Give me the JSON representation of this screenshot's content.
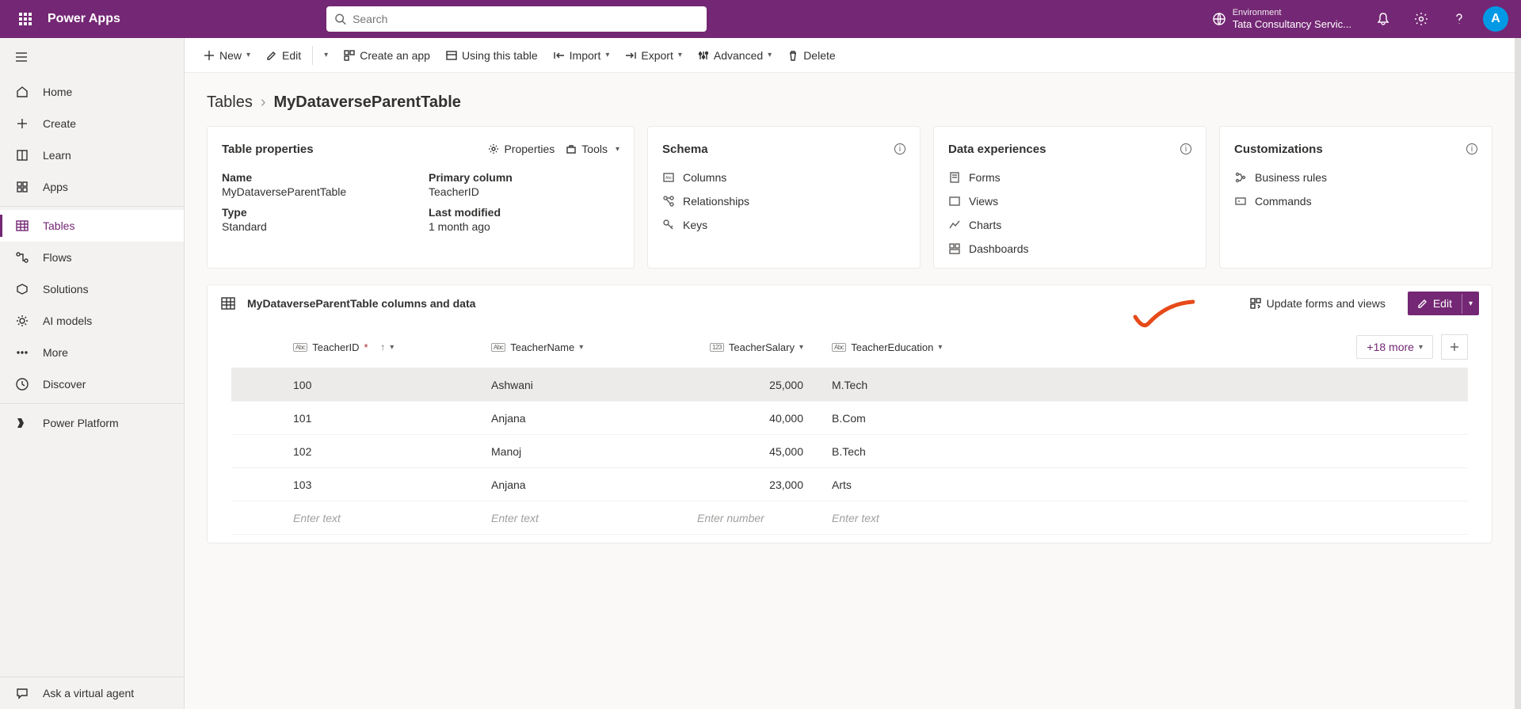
{
  "brand": "Power Apps",
  "search": {
    "placeholder": "Search"
  },
  "environment": {
    "label": "Environment",
    "name": "Tata Consultancy Servic..."
  },
  "avatar_initial": "A",
  "leftnav": {
    "items": [
      {
        "label": "Home"
      },
      {
        "label": "Create"
      },
      {
        "label": "Learn"
      },
      {
        "label": "Apps"
      },
      {
        "label": "Tables"
      },
      {
        "label": "Flows"
      },
      {
        "label": "Solutions"
      },
      {
        "label": "AI models"
      },
      {
        "label": "More"
      },
      {
        "label": "Discover"
      }
    ],
    "platform": "Power Platform",
    "ask": "Ask a virtual agent"
  },
  "toolbar": {
    "new": "New",
    "edit": "Edit",
    "create_app": "Create an app",
    "using_table": "Using this table",
    "import": "Import",
    "export": "Export",
    "advanced": "Advanced",
    "delete": "Delete"
  },
  "breadcrumb": {
    "root": "Tables",
    "current": "MyDataverseParentTable"
  },
  "properties_card": {
    "title": "Table properties",
    "properties_link": "Properties",
    "tools_link": "Tools",
    "name_label": "Name",
    "name_value": "MyDataverseParentTable",
    "primary_label": "Primary column",
    "primary_value": "TeacherID",
    "type_label": "Type",
    "type_value": "Standard",
    "modified_label": "Last modified",
    "modified_value": "1 month ago"
  },
  "schema_card": {
    "title": "Schema",
    "links": [
      "Columns",
      "Relationships",
      "Keys"
    ]
  },
  "data_card": {
    "title": "Data experiences",
    "links": [
      "Forms",
      "Views",
      "Charts",
      "Dashboards"
    ]
  },
  "custom_card": {
    "title": "Customizations",
    "links": [
      "Business rules",
      "Commands"
    ]
  },
  "grid": {
    "title": "MyDataverseParentTable columns and data",
    "update_link": "Update forms and views",
    "edit_btn": "Edit",
    "more_cols": "+18 more",
    "columns": [
      {
        "type": "Abc",
        "name": "TeacherID",
        "primary": true,
        "sort": "asc"
      },
      {
        "type": "Abc",
        "name": "TeacherName"
      },
      {
        "type": "123",
        "name": "TeacherSalary"
      },
      {
        "type": "Abc",
        "name": "TeacherEducation"
      }
    ],
    "rows": [
      {
        "id": "100",
        "name": "Ashwani",
        "salary": "25,000",
        "edu": "M.Tech",
        "selected": true
      },
      {
        "id": "101",
        "name": "Anjana",
        "salary": "40,000",
        "edu": "B.Com"
      },
      {
        "id": "102",
        "name": "Manoj",
        "salary": "45,000",
        "edu": "B.Tech"
      },
      {
        "id": "103",
        "name": "Anjana",
        "salary": "23,000",
        "edu": "Arts"
      }
    ],
    "new_row": {
      "text": "Enter text",
      "number": "Enter number"
    }
  }
}
